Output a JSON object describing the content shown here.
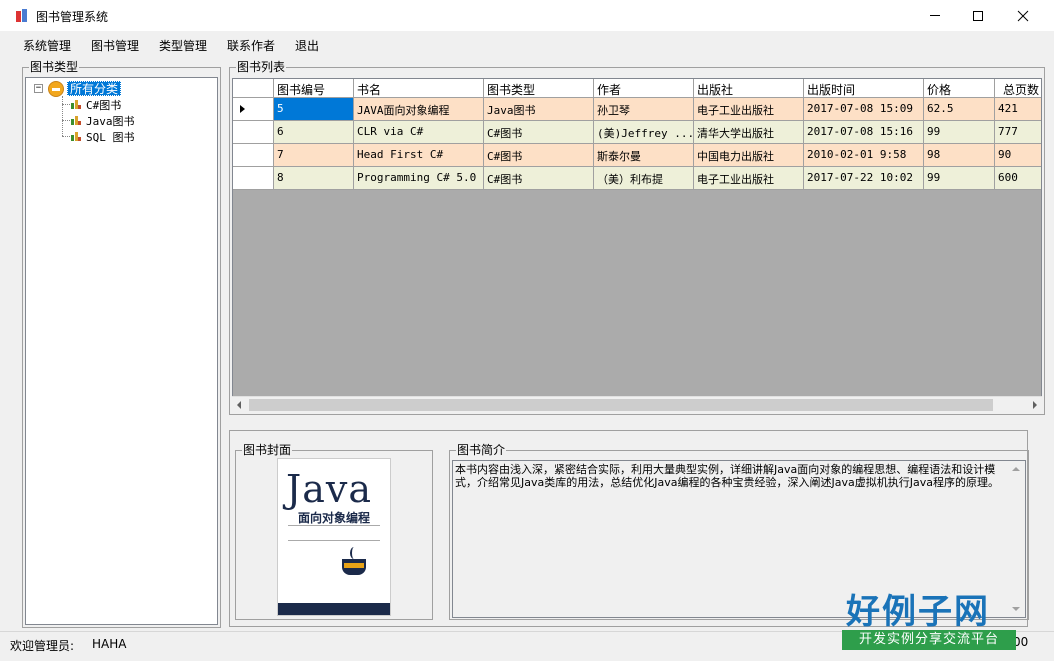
{
  "window": {
    "title": "图书管理系统"
  },
  "menu": [
    "系统管理",
    "图书管理",
    "类型管理",
    "联系作者",
    "退出"
  ],
  "tree_group": {
    "title": "图书类型",
    "root": {
      "label": "所有分类",
      "expander": "−"
    },
    "children": [
      "C#图书",
      "Java图书",
      "SQL 图书"
    ]
  },
  "book_list": {
    "title": "图书列表",
    "columns": [
      "图书编号",
      "书名",
      "图书类型",
      "作者",
      "出版社",
      "出版时间",
      "价格",
      "总页数"
    ],
    "rows": [
      [
        "5",
        "JAVA面向对象编程",
        "Java图书",
        "孙卫琴",
        "电子工业出版社",
        "2017-07-08 15:09",
        "62.5",
        "421"
      ],
      [
        "6",
        "CLR via C#",
        "C#图书",
        "(美)Jeffrey ...",
        "清华大学出版社",
        "2017-07-08 15:16",
        "99",
        "777"
      ],
      [
        "7",
        "Head First C#",
        "C#图书",
        "斯泰尔曼",
        "中国电力出版社",
        "2010-02-01 9:58",
        "98",
        "90"
      ],
      [
        "8",
        "Programming C# 5.0",
        "C#图书",
        "（美）利布提",
        "电子工业出版社",
        "2017-07-22 10:02",
        "99",
        "600"
      ]
    ]
  },
  "cover_group": {
    "title": "图书封面",
    "cover_main": "Java",
    "cover_sub": "面向对象编程"
  },
  "desc_group": {
    "title": "图书简介",
    "text": "本书内容由浅入深，紧密结合实际，利用大量典型实例，详细讲解Java面向对象的编程思想、编程语法和设计模式，介绍常见Java类库的用法，总结优化Java编程的各种宝贵经验，深入阐述Java虚拟机执行Java程序的原理。"
  },
  "status": {
    "label": "欢迎管理员:",
    "user": "HAHA",
    "trail": "00"
  },
  "watermark": {
    "title": "好例子网",
    "banner": "开发实例分享交流平台"
  },
  "colors": {
    "row_orange": "#fde0c6",
    "row_green": "#eef0d9",
    "selection": "#0078d7"
  }
}
